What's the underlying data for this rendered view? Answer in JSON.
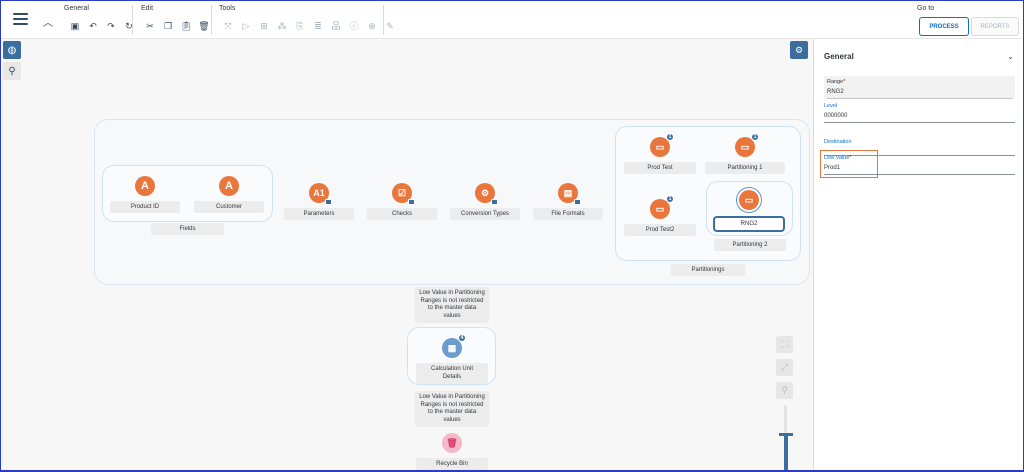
{
  "toolbar": {
    "groups": {
      "general": "General",
      "edit": "Edit",
      "tools": "Tools"
    },
    "goto_label": "Go to",
    "process_label": "PROCESS",
    "reports_label": "REPORTS"
  },
  "canvas": {
    "fields_group": {
      "label": "Fields",
      "nodes": [
        {
          "icon": "A",
          "label": "Product ID"
        },
        {
          "icon": "A",
          "label": "Customer"
        }
      ]
    },
    "nodes": [
      {
        "icon": "A1",
        "label": "Parameters"
      },
      {
        "icon": "checks-icon",
        "label": "Checks"
      },
      {
        "icon": "conversion-icon",
        "label": "Conversion Types"
      },
      {
        "icon": "file-icon",
        "label": "File Formats"
      }
    ],
    "partitionings_group": {
      "label": "Partitionings",
      "nodes": [
        {
          "label": "Prod Test",
          "badge": "1"
        },
        {
          "label": "Partitioning 1",
          "badge": "1"
        },
        {
          "label": "Prod Test2",
          "badge": "1"
        }
      ],
      "partitioning2": {
        "label": "Partitioning 2",
        "selected_node": "RNG2"
      }
    },
    "note1": "Low Value in Partitioning Ranges is not restricted to the master data values",
    "calc_unit": {
      "label": "Calculation Unit Details",
      "badge": "4"
    },
    "note2": "Low Value in Partitioning Ranges is not restricted to the master data values",
    "recycle_bin": "Recycle Bin"
  },
  "panel": {
    "title": "General",
    "fields": {
      "range_label": "Range",
      "range_value": "RNG2",
      "level_label": "Level",
      "level_value": "0000000",
      "destination_label": "Destination",
      "destination_value": "",
      "low_value_label": "Low Value",
      "low_value_value": "Prod1"
    }
  },
  "colors": {
    "accent": "#0a6ed1",
    "node_orange": "#e9773d",
    "node_blue": "#6a9ccc",
    "highlight": "#e9773d"
  }
}
